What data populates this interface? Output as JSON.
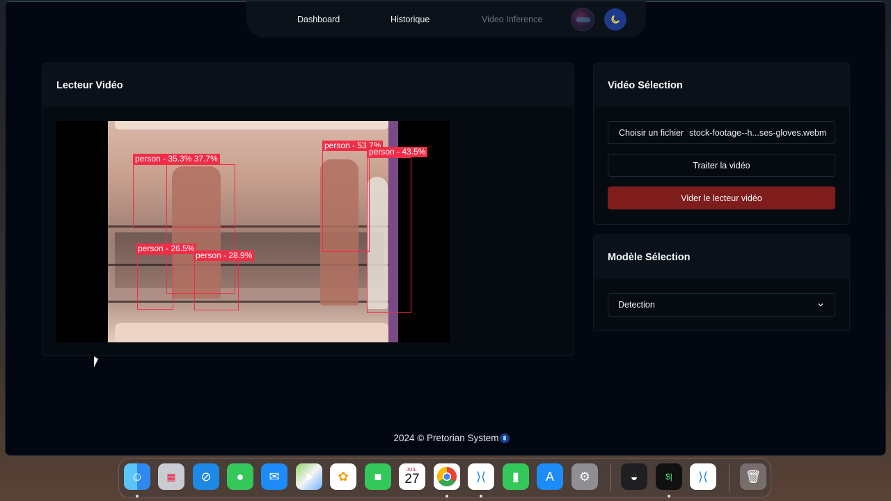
{
  "nav": {
    "links": [
      {
        "label": "Dashboard"
      },
      {
        "label": "Historique"
      },
      {
        "label": "Video Inference"
      }
    ]
  },
  "player": {
    "title": "Lecteur Vidéo",
    "detections": [
      {
        "label": "person - 35.3% 37.7%"
      },
      {
        "label": "person - 53.7%"
      },
      {
        "label": "person - 43.5%"
      },
      {
        "label": "person - 26.5%"
      },
      {
        "label": "person - 28.9%"
      }
    ]
  },
  "video_selection": {
    "title": "Vidéo Sélection",
    "choose_file_label": "Choisir un fichier",
    "file_name": "stock-footage--h...ses-gloves.webm",
    "process_label": "Traiter la vidéo",
    "clear_label": "Vider le lecteur vidéo"
  },
  "model_selection": {
    "title": "Modèle Sélection",
    "selected": "Detection"
  },
  "footer": {
    "text": "2024 © Pretorian System"
  },
  "dock": {
    "calendar_month": "JUIL.",
    "calendar_day": "27",
    "items": [
      "finder-icon",
      "launchpad-icon",
      "safari-icon",
      "messages-icon",
      "mail-icon",
      "maps-icon",
      "photos-icon",
      "facetime-icon",
      "calendar-icon",
      "chrome-icon",
      "vscode-icon",
      "numbers-icon",
      "app-store-icon",
      "system-settings-icon",
      "linear-icon",
      "terminal-icon",
      "vscode-icon-2",
      "trash-icon"
    ]
  },
  "colors": {
    "accent_red": "#7f1d1d",
    "detection_red": "#f02d47",
    "theme_button": "#1e3a8a"
  }
}
